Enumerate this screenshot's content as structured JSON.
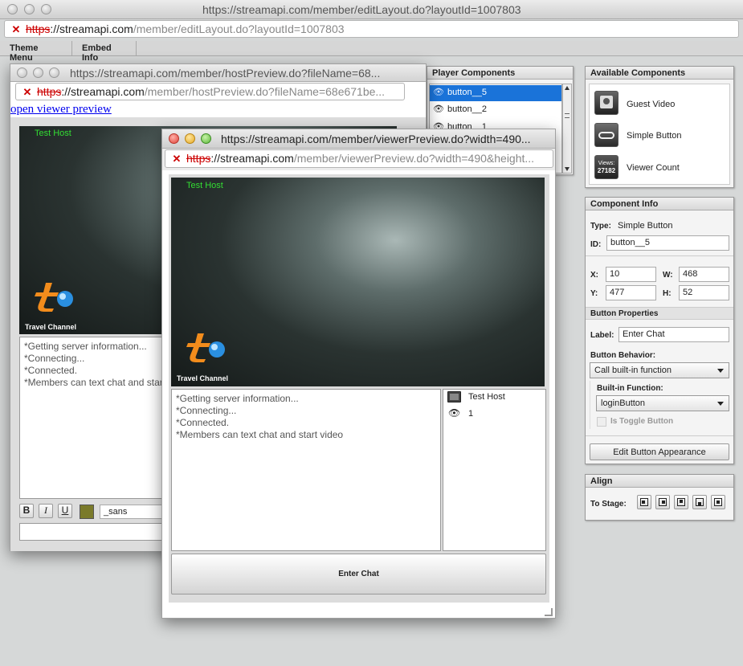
{
  "main_window": {
    "title": "https://streamapi.com/member/editLayout.do?layoutId=1007803",
    "url": {
      "proto": "https",
      "domain": "://streamapi.com",
      "path": "/member/editLayout.do?layoutId=1007803"
    }
  },
  "tabs": [
    {
      "label": "Theme Menu"
    },
    {
      "label": "Embed Info"
    }
  ],
  "player_components": {
    "title": "Player Components",
    "items": [
      {
        "label": "button__5"
      },
      {
        "label": "button__2"
      },
      {
        "label": "button__1"
      }
    ]
  },
  "available_components": {
    "title": "Available Components",
    "items": [
      {
        "label": "Guest Video"
      },
      {
        "label": "Simple Button"
      },
      {
        "label": "Viewer Count"
      }
    ],
    "viewer_icon_text": "Views:",
    "viewer_icon_count": "27182"
  },
  "component_info": {
    "title": "Component Info",
    "type_label": "Type:",
    "type_value": "Simple Button",
    "id_label": "ID:",
    "id_value": "button__5",
    "x_label": "X:",
    "x_value": "10",
    "w_label": "W:",
    "w_value": "468",
    "y_label": "Y:",
    "y_value": "477",
    "h_label": "H:",
    "h_value": "52",
    "button_props_title": "Button Properties",
    "label_label": "Label:",
    "label_value": "Enter Chat",
    "behavior_label": "Button Behavior:",
    "behavior_value": "Call built-in function",
    "builtin_label": "Built-in Function:",
    "builtin_value": "loginButton",
    "toggle_label": "Is Toggle Button",
    "edit_button": "Edit Button Appearance"
  },
  "align": {
    "title": "Align",
    "to_stage": "To Stage:"
  },
  "host_window": {
    "title": "https://streamapi.com/member/hostPreview.do?fileName=68...",
    "url": {
      "proto": "https",
      "domain": "://streamapi.com",
      "path": "/member/hostPreview.do?fileName=68e671be..."
    },
    "open_link": "open viewer preview",
    "host_label": "Test Host",
    "logo_text": "Travel Channel",
    "chat_lines": [
      "*Getting server information...",
      "*Connecting...",
      "*Connected.",
      "*Members can text chat and start"
    ],
    "font_value": "_sans",
    "color_swatch": "#7a7a2a"
  },
  "viewer_window": {
    "title": "https://streamapi.com/member/viewerPreview.do?width=490...",
    "url": {
      "proto": "https",
      "domain": "://streamapi.com",
      "path": "/member/viewerPreview.do?width=490&height..."
    },
    "host_label": "Test Host",
    "logo_text": "Travel Channel",
    "chat_lines": [
      "*Getting server information...",
      "*Connecting...",
      "*Connected.",
      "*Members can text chat and start video"
    ],
    "users": [
      {
        "name": "Test Host"
      },
      {
        "name": "1"
      }
    ],
    "enter_chat": "Enter Chat"
  },
  "colors": {
    "selection": "#1a73d9",
    "host_green": "#33dd33",
    "logo_orange": "#f28c1c"
  }
}
